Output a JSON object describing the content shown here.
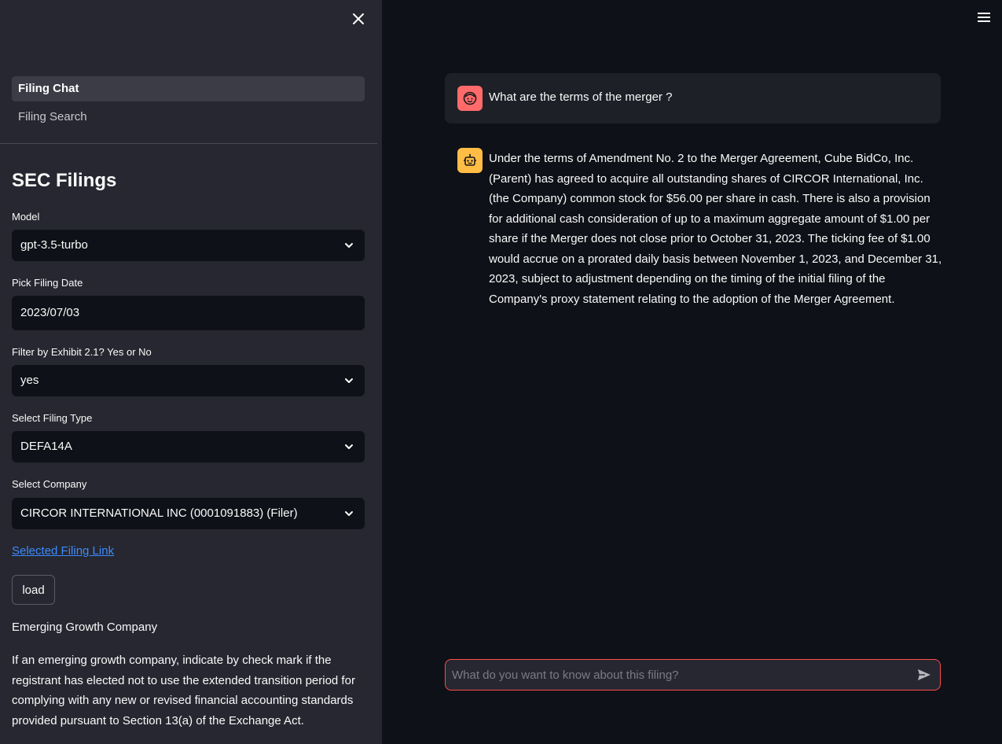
{
  "sidebar": {
    "nav": [
      {
        "label": "Filing Chat",
        "active": true
      },
      {
        "label": "Filing Search",
        "active": false
      }
    ],
    "title": "SEC Filings",
    "model": {
      "label": "Model",
      "value": "gpt-3.5-turbo"
    },
    "filing_date": {
      "label": "Pick Filing Date",
      "value": "2023/07/03"
    },
    "exhibit_filter": {
      "label": "Filter by Exhibit 2.1? Yes or No",
      "value": "yes"
    },
    "filing_type": {
      "label": "Select Filing Type",
      "value": "DEFA14A"
    },
    "company": {
      "label": "Select Company",
      "value": "CIRCOR INTERNATIONAL INC (0001091883) (Filer)"
    },
    "filing_link": "Selected Filing Link",
    "load_label": "load",
    "egc_heading": "Emerging Growth Company",
    "egc_text": "If an emerging growth company, indicate by check mark if the registrant has elected not to use the extended transition period for complying with any new or revised financial accounting standards provided pursuant to Section 13(a) of the Exchange Act."
  },
  "chat": {
    "user_message": "What are the terms of the merger ?",
    "bot_message": "Under the terms of Amendment No. 2 to the Merger Agreement, Cube BidCo, Inc. (Parent) has agreed to acquire all outstanding shares of CIRCOR International, Inc. (the Company) common stock for $56.00 per share in cash. There is also a provision for additional cash consideration of up to a maximum aggregate amount of $1.00 per share if the Merger does not close prior to October 31, 2023. The ticking fee of $1.00 would accrue on a prorated daily basis between November 1, 2023, and December 31, 2023, subject to adjustment depending on the timing of the initial filing of the Company's proxy statement relating to the adoption of the Merger Agreement.",
    "input_placeholder": "What do you want to know about this filing?"
  },
  "colors": {
    "sidebar_bg": "#262730",
    "main_bg": "#0e1117",
    "user_avatar": "#ff6b6b",
    "bot_avatar": "#ffbd45",
    "input_border": "#ff4b4b",
    "link": "#3d8bfd"
  },
  "icons": {
    "close": "close-icon",
    "menu": "hamburger-menu-icon",
    "chevron": "chevron-down-icon",
    "user_avatar": "user-face-icon",
    "bot_avatar": "robot-icon",
    "send": "send-icon"
  }
}
